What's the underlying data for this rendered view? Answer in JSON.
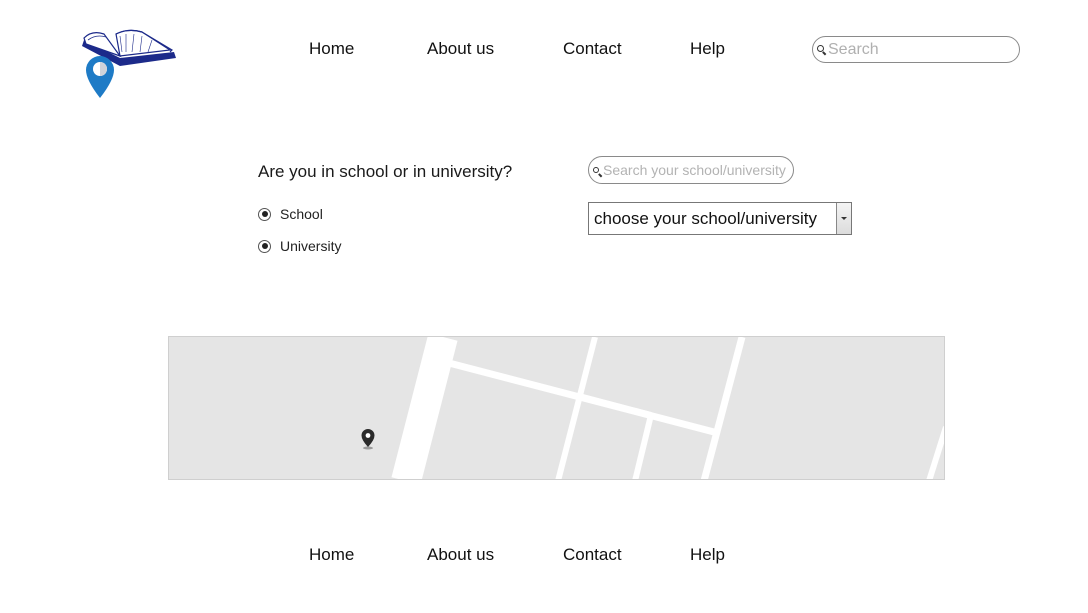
{
  "header": {
    "nav": [
      {
        "label": "Home"
      },
      {
        "label": "About us"
      },
      {
        "label": "Contact"
      },
      {
        "label": "Help"
      }
    ],
    "search": {
      "placeholder": "Search"
    }
  },
  "form": {
    "question": "Are you in school or in university?",
    "options": [
      {
        "label": "School",
        "selected": true
      },
      {
        "label": "University",
        "selected": true
      }
    ],
    "school_search": {
      "placeholder": "Search your school/university"
    },
    "select": {
      "value": "choose your school/university"
    }
  },
  "map": {
    "marker_icon": "map-pin-icon"
  },
  "footer": {
    "nav": [
      {
        "label": "Home"
      },
      {
        "label": "About us"
      },
      {
        "label": "Contact"
      },
      {
        "label": "Help"
      }
    ]
  },
  "colors": {
    "pin_blue": "#1e7bc6",
    "book_navy": "#1c2a8a",
    "map_bg": "#e5e5e5"
  }
}
